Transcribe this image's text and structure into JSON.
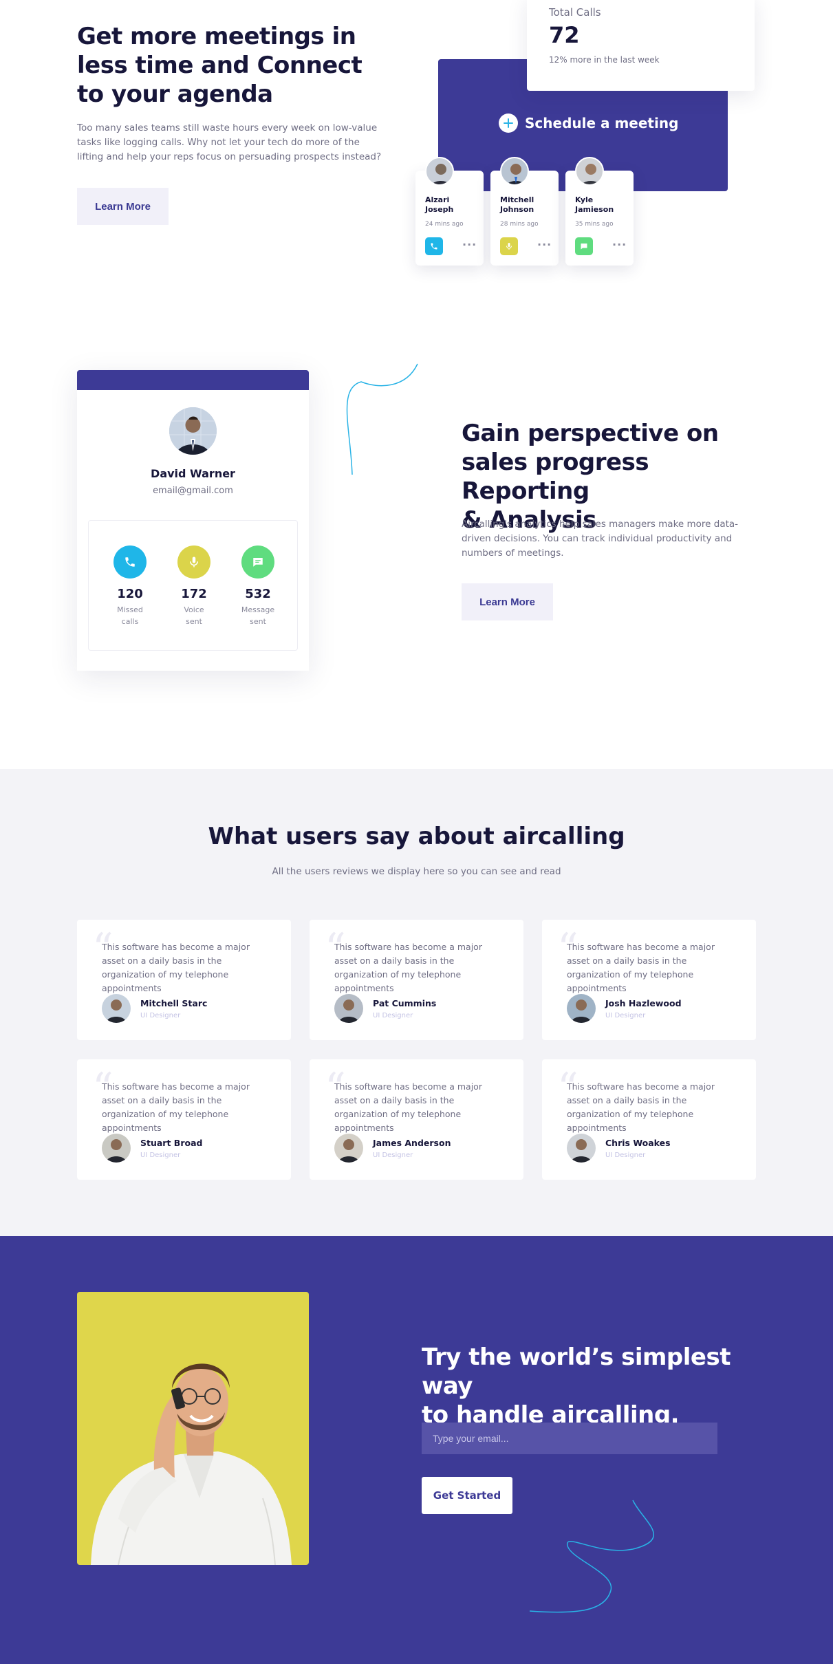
{
  "hero": {
    "title_line1": "Get more meetings in",
    "title_line2": "less time and Connect",
    "title_line3": "to your agenda",
    "description": "Too many sales teams still waste hours every week on low-value tasks like logging calls. Why not let your tech do more of the lifting and help your reps focus on persuading prospects instead?",
    "cta_label": "Learn More",
    "total_calls": {
      "label": "Total Calls",
      "value": "72",
      "note": "12% more in the last week"
    },
    "schedule_label": "Schedule a meeting",
    "call_cards": [
      {
        "name_line1": "Alzari",
        "name_line2": "Joseph",
        "time": "24 mins ago",
        "action_icon": "phone-icon",
        "action_color": "#1fb6e8"
      },
      {
        "name_line1": "Mitchell",
        "name_line2": "Johnson",
        "time": "28 mins ago",
        "action_icon": "mic-icon",
        "action_color": "#dbd44a"
      },
      {
        "name_line1": "Kyle",
        "name_line2": "Jamieson",
        "time": "35 mins ago",
        "action_icon": "message-icon",
        "action_color": "#5fdc7f"
      }
    ]
  },
  "analytics": {
    "profile": {
      "name": "David Warner",
      "email": "email@gmail.com",
      "stats": [
        {
          "value": "120",
          "label_line1": "Missed",
          "label_line2": "calls",
          "icon": "phone-icon",
          "color": "#1fb6e8"
        },
        {
          "value": "172",
          "label_line1": "Voice",
          "label_line2": "sent",
          "icon": "mic-icon",
          "color": "#dbd44a"
        },
        {
          "value": "532",
          "label_line1": "Message",
          "label_line2": "sent",
          "icon": "message-icon",
          "color": "#5fdc7f"
        }
      ]
    },
    "title_line1": "Gain perspective on",
    "title_line2": "sales progress Reporting",
    "title_line3": "& Analysis",
    "description": "Aircalling's analytics help sales managers make more data-driven decisions. You can track individual productivity and numbers of meetings.",
    "cta_label": "Learn More"
  },
  "reviews": {
    "title": "What users say about aircalling",
    "subtitle": "All the users reviews we display here so you can see and read",
    "items": [
      {
        "text": "This software has become a major asset on a daily basis in the organization of my telephone appointments",
        "name": "Mitchell Starc",
        "role": "UI Designer"
      },
      {
        "text": "This software has become a major asset on a daily basis in the organization of my telephone appointments",
        "name": "Pat Cummins",
        "role": "UI Designer"
      },
      {
        "text": "This software has become a major asset on a daily basis in the organization of my telephone appointments",
        "name": "Josh Hazlewood",
        "role": "UI Designer"
      },
      {
        "text": "This software has become a major asset on a daily basis in the organization of my telephone appointments",
        "name": "Stuart Broad",
        "role": "UI Designer"
      },
      {
        "text": "This software has become a major asset on a daily basis in the organization of my telephone appointments",
        "name": "James Anderson",
        "role": "UI Designer"
      },
      {
        "text": "This software has become a major asset on a daily basis in the organization of my telephone appointments",
        "name": "Chris Woakes",
        "role": "UI Designer"
      }
    ]
  },
  "cta": {
    "title_line1": "Try the world’s simplest way",
    "title_line2": "to handle aircalling.",
    "email_placeholder": "Type your email...",
    "button_label": "Get Started"
  },
  "colors": {
    "brand_purple": "#3d3a96",
    "heading": "#17163a",
    "phone": "#1fb6e8",
    "voice": "#dbd44a",
    "message": "#5fdc7f",
    "accent_line": "#29b3e6"
  }
}
